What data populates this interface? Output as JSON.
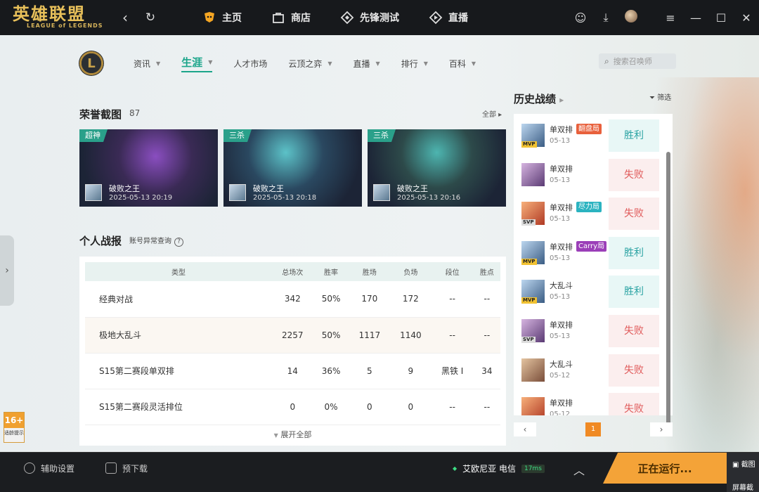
{
  "app": {
    "logo_cn": "英雄联盟",
    "logo_en": "LEAGUE of LEGENDS",
    "top_nav": [
      {
        "label": "主页",
        "icon": "home-fox-icon"
      },
      {
        "label": "商店",
        "icon": "shop-bag-icon"
      },
      {
        "label": "先锋测试",
        "icon": "pioneer-test-icon"
      },
      {
        "label": "直播",
        "icon": "live-stream-icon"
      }
    ]
  },
  "subnav": {
    "items": [
      {
        "label": "资讯",
        "caret": true
      },
      {
        "label": "生涯",
        "caret": true,
        "active": true
      },
      {
        "label": "人才市场",
        "caret": false
      },
      {
        "label": "云顶之弈",
        "caret": true
      },
      {
        "label": "直播",
        "caret": true
      },
      {
        "label": "排行",
        "caret": true
      },
      {
        "label": "百科",
        "caret": true
      }
    ],
    "search_placeholder": "搜索召唤师"
  },
  "honor": {
    "title": "荣誉截图",
    "count": "87",
    "all_label": "全部",
    "shots": [
      {
        "tag": "超神",
        "name": "破败之王",
        "time": "2025-05-13 20:19"
      },
      {
        "tag": "三杀",
        "name": "破败之王",
        "time": "2025-05-13 20:18"
      },
      {
        "tag": "三杀",
        "name": "破败之王",
        "time": "2025-05-13 20:16"
      }
    ]
  },
  "report": {
    "title": "个人战报",
    "abnormal_link": "账号异常查询",
    "headers": [
      "类型",
      "总场次",
      "胜率",
      "胜场",
      "负场",
      "段位",
      "胜点"
    ],
    "rows": [
      [
        "经典对战",
        "342",
        "50%",
        "170",
        "172",
        "--",
        "--"
      ],
      [
        "极地大乱斗",
        "2257",
        "50%",
        "1117",
        "1140",
        "--",
        "--"
      ],
      [
        "S15第二赛段单双排",
        "14",
        "36%",
        "5",
        "9",
        "黑铁 I",
        "34"
      ],
      [
        "S15第二赛段灵活排位",
        "0",
        "0%",
        "0",
        "0",
        "--",
        "--"
      ]
    ],
    "expand_label": "展开全部"
  },
  "history": {
    "title": "历史战绩",
    "filter_label": "筛选",
    "matches": [
      {
        "mode": "单双排",
        "date": "05-13",
        "tag": "翻盘局",
        "tag_color": "#e8603c",
        "badge": "MVP",
        "result": "胜利",
        "win": true
      },
      {
        "mode": "单双排",
        "date": "05-13",
        "tag": "",
        "badge": "",
        "result": "失败",
        "win": false
      },
      {
        "mode": "单双排",
        "date": "05-13",
        "tag": "尽力局",
        "tag_color": "#2bb3c0",
        "badge": "SVP",
        "result": "失败",
        "win": false
      },
      {
        "mode": "单双排",
        "date": "05-13",
        "tag": "Carry局",
        "tag_color": "#9b3fb8",
        "badge": "MVP",
        "result": "胜利",
        "win": true
      },
      {
        "mode": "大乱斗",
        "date": "05-13",
        "tag": "",
        "badge": "MVP",
        "result": "胜利",
        "win": true
      },
      {
        "mode": "单双排",
        "date": "05-13",
        "tag": "",
        "badge": "SVP",
        "result": "失败",
        "win": false
      },
      {
        "mode": "大乱斗",
        "date": "05-12",
        "tag": "",
        "badge": "",
        "result": "失败",
        "win": false
      },
      {
        "mode": "单双排",
        "date": "05-12",
        "tag": "",
        "badge": "",
        "result": "失败",
        "win": false
      }
    ],
    "page": "1"
  },
  "age_rating": {
    "num": "16+",
    "text": "适龄提示"
  },
  "bottom": {
    "assist": "辅助设置",
    "predownload": "预下载",
    "server": "艾欧尼亚 电信",
    "ping": "17ms",
    "running": "正在运行...",
    "screenshot_label": "截图",
    "screenshot_label2": "屏幕截"
  },
  "colors": {
    "accent": "#1ba58a",
    "win": "#2aa3a3",
    "lose": "#e05a5a",
    "run": "#f4a338"
  }
}
